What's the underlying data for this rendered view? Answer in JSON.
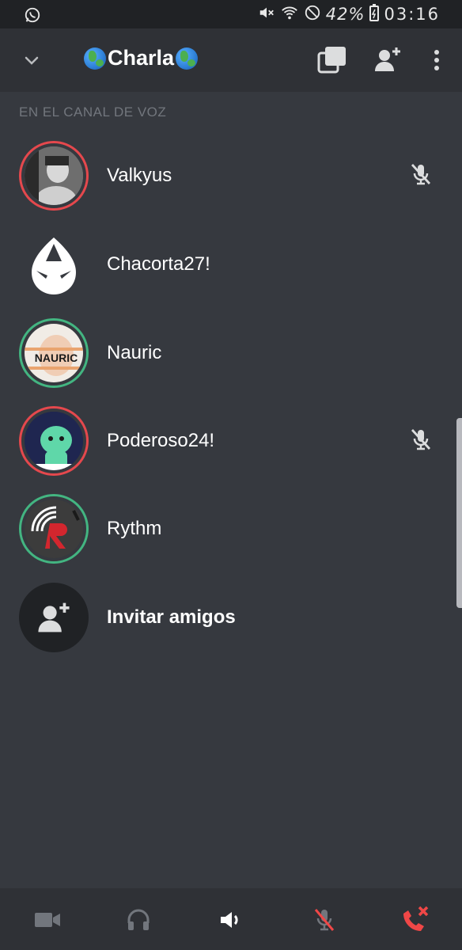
{
  "status_bar": {
    "battery_percent": "42%",
    "time": "03:16"
  },
  "header": {
    "channel_name": "Charla",
    "icons": [
      "chevron-down-icon",
      "globe-emoji",
      "screen-share-icon",
      "add-user-icon",
      "more-vertical-icon"
    ]
  },
  "section": {
    "label": "EN EL CANAL DE VOZ"
  },
  "members": [
    {
      "name": "Valkyus",
      "ring": "red",
      "muted": true
    },
    {
      "name": "Chacorta27!",
      "ring": "none",
      "muted": false
    },
    {
      "name": "Nauric",
      "ring": "green",
      "muted": false,
      "avatar_text": "NAURIC"
    },
    {
      "name": "Poderoso24!",
      "ring": "red",
      "muted": true
    },
    {
      "name": "Rythm",
      "ring": "green",
      "muted": false
    }
  ],
  "invite": {
    "label": "Invitar amigos"
  },
  "bottom_bar": {
    "icons": [
      "video-camera-icon",
      "headphones-icon",
      "speaker-icon",
      "mic-muted-icon",
      "hang-up-icon"
    ]
  },
  "colors": {
    "background": "#36393f",
    "header": "#2f3136",
    "status_bar": "#202225",
    "red_ring": "#e5484d",
    "green_ring": "#43b581",
    "muted_text": "#72767d"
  }
}
